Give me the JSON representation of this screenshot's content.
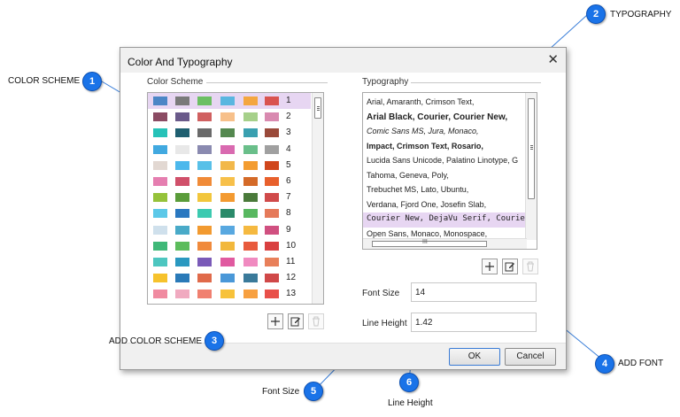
{
  "dialog": {
    "title": "Color And Typography",
    "close_glyph": "✕",
    "color_scheme_label": "Color Scheme",
    "typography_label": "Typography",
    "font_size_label": "Font Size",
    "font_size_value": "14",
    "line_height_label": "Line Height",
    "line_height_value": "1.42",
    "ok_label": "OK",
    "cancel_label": "Cancel"
  },
  "color_schemes": [
    {
      "num": "1",
      "colors": [
        "#4b86c6",
        "#7a7a7a",
        "#6cbf63",
        "#5ab6e0",
        "#f4a640",
        "#d9534f"
      ]
    },
    {
      "num": "2",
      "colors": [
        "#8b4b63",
        "#6a5a8a",
        "#d06060",
        "#f7c08a",
        "#a6d08a",
        "#d98ab0"
      ]
    },
    {
      "num": "3",
      "colors": [
        "#26c2b8",
        "#1f5f70",
        "#6a6a6a",
        "#54884f",
        "#3aa0b0",
        "#9a4a3a"
      ]
    },
    {
      "num": "4",
      "colors": [
        "#41a9e0",
        "#e8e8e8",
        "#8a8ab0",
        "#d96ab0",
        "#6abf8a",
        "#a0a0a0"
      ]
    },
    {
      "num": "5",
      "colors": [
        "#e2d8d2",
        "#4cb8ec",
        "#58c0e8",
        "#f2b84a",
        "#f39c30",
        "#d0461c"
      ]
    },
    {
      "num": "6",
      "colors": [
        "#e57eb0",
        "#d0506a",
        "#f08b38",
        "#f7c04a",
        "#d46a28",
        "#e8602c"
      ]
    },
    {
      "num": "7",
      "colors": [
        "#95c23a",
        "#5a9c3a",
        "#f2c63c",
        "#f39a30",
        "#4a7a3a",
        "#d04a4a"
      ]
    },
    {
      "num": "8",
      "colors": [
        "#5cc8e8",
        "#2a78c0",
        "#3ccab0",
        "#2a8a6a",
        "#58b860",
        "#e57a5a"
      ]
    },
    {
      "num": "9",
      "colors": [
        "#cfe0ec",
        "#49aac8",
        "#f29a30",
        "#58a8e0",
        "#f5b940",
        "#d05080"
      ]
    },
    {
      "num": "10",
      "colors": [
        "#3fb878",
        "#5cbc5c",
        "#f08a3c",
        "#f2b83c",
        "#e85a3c",
        "#d94040"
      ]
    },
    {
      "num": "11",
      "colors": [
        "#4dc6c0",
        "#2a98c0",
        "#7a5ab8",
        "#e05aa0",
        "#f08ac0",
        "#e8805a"
      ]
    },
    {
      "num": "12",
      "colors": [
        "#f6c22c",
        "#2a7ab8",
        "#e06a4a",
        "#4a98d8",
        "#3a7a9a",
        "#d04848"
      ]
    },
    {
      "num": "13",
      "colors": [
        "#f08aa0",
        "#f0aac0",
        "#f08070",
        "#f7c23a",
        "#f7a040",
        "#e8504a"
      ]
    }
  ],
  "typography_rows": [
    "Arial, Amaranth, Crimson Text,",
    "Arial Black, Courier, Courier New,",
    "Comic Sans MS, Jura, Monaco,",
    "Impact, Crimson Text, Rosario,",
    "Lucida Sans Unicode, Palatino Linotype, G",
    "Tahoma, Geneva, Poly,",
    "Trebuchet MS, Lato, Ubuntu,",
    "Verdana, Fjord One, Josefin Slab,",
    "Courier New, DejaVu Serif, Courier,",
    "Open Sans, Monaco, Monospace,"
  ],
  "hscroll_glyph": "III",
  "callouts": [
    {
      "num": "1",
      "label": "COLOR SCHEME"
    },
    {
      "num": "2",
      "label": "TYPOGRAPHY"
    },
    {
      "num": "3",
      "label": "ADD COLOR SCHEME"
    },
    {
      "num": "4",
      "label": "ADD FONT"
    },
    {
      "num": "5",
      "label": "Font Size"
    },
    {
      "num": "6",
      "label": "Line Height"
    }
  ],
  "colors": {
    "accent": "#1a73e8",
    "selection": "#e7d6f2"
  },
  "icons": [
    "plus-icon",
    "edit-icon",
    "trash-icon",
    "close-icon"
  ]
}
